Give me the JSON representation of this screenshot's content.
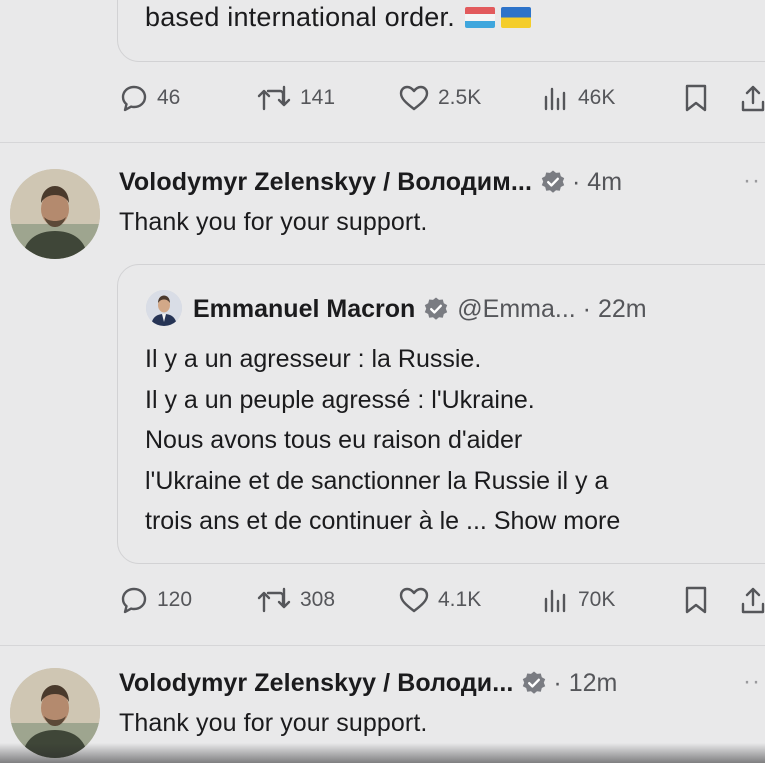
{
  "top_quote": {
    "text": "based international order."
  },
  "top_actions": {
    "replies": "46",
    "reposts": "141",
    "likes": "2.5K",
    "views": "46K"
  },
  "tweet1": {
    "author": "Volodymyr Zelenskyy / Володим...",
    "time": "· 4m",
    "text": "Thank you for your support.",
    "quote": {
      "author": "Emmanuel Macron",
      "handle_time": "@Emma... · 22m",
      "lines": [
        "Il y a un agresseur : la Russie.",
        "Il y a un peuple agressé : l'Ukraine.",
        "Nous avons tous eu raison d'aider",
        "l'Ukraine et de sanctionner la Russie il y a",
        "trois ans et de continuer à le ..."
      ],
      "show_more": "Show more"
    },
    "actions": {
      "replies": "120",
      "reposts": "308",
      "likes": "4.1K",
      "views": "70K"
    }
  },
  "tweet2": {
    "author": "Volodymyr Zelenskyy / Володи...",
    "time": "· 12m",
    "text": "Thank you for your support."
  },
  "colors": {
    "background": "#e9e9ea",
    "verified_badge": "#7a7c82",
    "muted_text": "#55565a"
  },
  "icons": [
    "reply-icon",
    "repost-icon",
    "like-icon",
    "views-icon",
    "bookmark-icon",
    "share-icon",
    "verified-badge-icon",
    "luxembourg-flag-icon",
    "ukraine-flag-icon"
  ]
}
